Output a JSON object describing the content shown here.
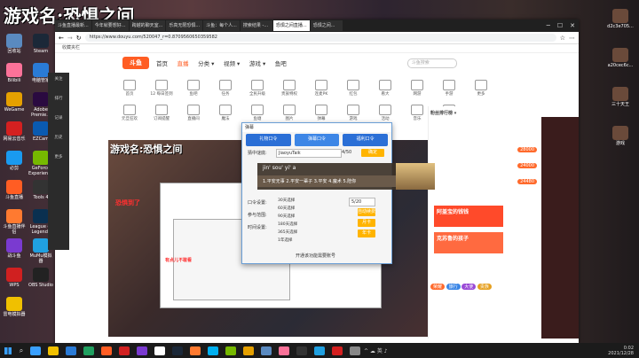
{
  "overlay_title": "游戏名:恐惧之间",
  "desktop_left": [
    {
      "label": "回收站",
      "color": "#5a8ac0"
    },
    {
      "label": "Steam",
      "color": "#1b2838"
    },
    {
      "label": "Bilibili",
      "color": "#fb7299"
    },
    {
      "label": "电脑管家",
      "color": "#2a7bd6"
    },
    {
      "label": "WeGame",
      "color": "#e5a000"
    },
    {
      "label": "Adobe Premie...",
      "color": "#2a0a40"
    },
    {
      "label": "网易云音乐",
      "color": "#d42020"
    },
    {
      "label": "EZCam",
      "color": "#0a5ab0"
    },
    {
      "label": "必剪",
      "color": "#1a9af0"
    },
    {
      "label": "GeForce Experience",
      "color": "#76b900"
    },
    {
      "label": "斗鱼直播",
      "color": "#ff5d23"
    },
    {
      "label": "Tools 4",
      "color": "#333"
    },
    {
      "label": "斗鱼直播伴侣",
      "color": "#ff7a30"
    },
    {
      "label": "League of Legends",
      "color": "#0a3050"
    },
    {
      "label": "战斗鱼",
      "color": "#7a3ad0"
    },
    {
      "label": "MuMu模拟器",
      "color": "#20a0e0"
    },
    {
      "label": "WPS",
      "color": "#d02020"
    },
    {
      "label": "OBS Studio",
      "color": "#222"
    },
    {
      "label": "雷电模拟器",
      "color": "#f0c000"
    }
  ],
  "desktop_right": [
    {
      "label": "d2c3e705..."
    },
    {
      "label": "a20cec6c..."
    },
    {
      "label": "三十天王"
    },
    {
      "label": "游戏"
    }
  ],
  "browser": {
    "tabs": [
      "斗鱼直播最新...",
      "今年就要想好...",
      "跨越的聊天室...",
      "乐高无限恐惧...",
      "斗鱼：每个人...",
      "搜索结果 -...",
      "恐惧之间直播...",
      "恐惧之间..."
    ],
    "active_tab_index": 6,
    "url": "https://www.douyu.com/520047_r=0.8709560650359582",
    "favorites": "收藏夹栏",
    "window_controls": [
      "─",
      "☐",
      "✕"
    ]
  },
  "site": {
    "logo": "斗鱼",
    "nav": [
      "首页",
      "直播",
      "分类 ▾",
      "视频 ▾",
      "游戏 ▾",
      "鱼吧"
    ],
    "search_placeholder": "斗鱼搜索"
  },
  "categories": [
    "首页",
    "12 每日签到",
    "鱼吧",
    "任务",
    "全民升级",
    "贵族特权",
    "连麦PK",
    "红包",
    "看大",
    "网游",
    "手游",
    "更多"
  ],
  "categories_row2": [
    "元旦狂欢",
    "订阅提醒",
    "直播间",
    "魔法",
    "鱼塘",
    "图片",
    "弹幕",
    "游戏",
    "活动",
    "音乐",
    "设置"
  ],
  "left_dock": [
    "关注",
    "排行",
    "记录",
    "历史",
    "更多"
  ],
  "stream": {
    "title": "游戏名:恐惧之间",
    "red_text_1": "恐惧到了",
    "red_text_2": "有点儿不敢看"
  },
  "dialog": {
    "title": "弹幕",
    "tabs": [
      "礼物口令",
      "弹幕口令",
      "福利口令"
    ],
    "labels": [
      "猜中谜底:",
      "口令设置:",
      "参与范围:",
      "时间设置:"
    ],
    "answer_value": "JiaoyuTaik",
    "counter": "4/50",
    "confirm": "确定",
    "options": [
      "30天选择",
      "60天选择",
      "90天选择",
      "180天选择",
      "365天选择",
      "1年选择"
    ],
    "side_btns": [
      "自动续费",
      "月卡",
      "年卡"
    ],
    "input_time": "5/20",
    "footer": "开通该功能需要账号"
  },
  "ime": {
    "pinyin": "jin' sou' yi' a",
    "candidates": "1.平安无事  2.平安一辈子  3.平安  4.魔术  5.陪你"
  },
  "chat": {
    "fans_label": "粉丝排行榜 ▾",
    "amounts": [
      "28000",
      "24000",
      "24480"
    ],
    "banner1": "阿盖宝的钱钱",
    "banner2": "克苏鲁的孩子",
    "tags": [
      "荣耀",
      "旅行",
      "大使",
      "贵族"
    ]
  },
  "taskbar": {
    "time": "0:02",
    "date": "2021/12/28",
    "tray_glyphs": "^ ☁ 英 ♪"
  }
}
